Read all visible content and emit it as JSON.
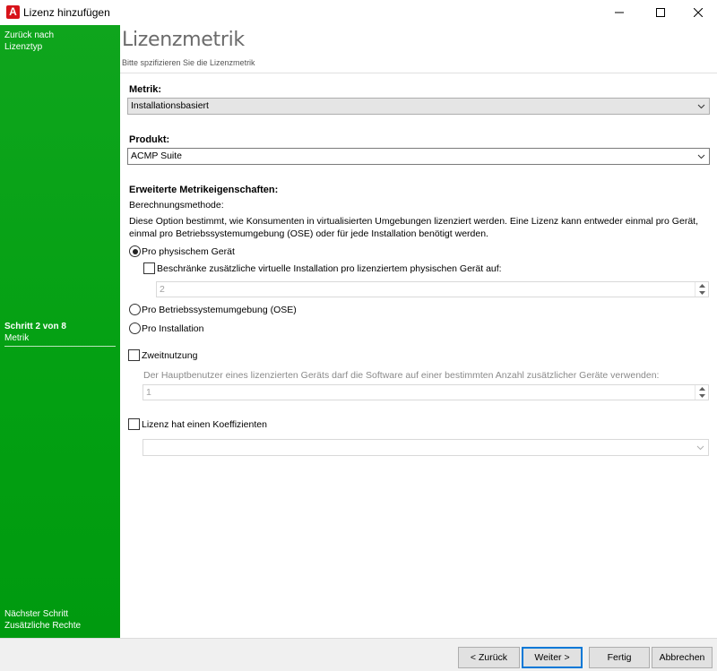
{
  "window": {
    "app_icon_letter": "A",
    "title": "Lizenz hinzufügen"
  },
  "sidebar": {
    "back_line1": "Zurück nach",
    "back_line2": "Lizenztyp",
    "step_label": "Schritt 2 von 8",
    "step_name": "Metrik",
    "next_line1": "Nächster Schritt",
    "next_line2": "Zusätzliche Rechte"
  },
  "header": {
    "title": "Lizenzmetrik",
    "subtitle": "Bitte spzifizieren Sie die Lizenzmetrik"
  },
  "form": {
    "metrik_label": "Metrik:",
    "metrik_value": "Installationsbasiert",
    "produkt_label": "Produkt:",
    "produkt_value": "ACMP Suite",
    "advanced_label": "Erweiterte Metrikeigenschaften:",
    "method_label": "Berechnungsmethode:",
    "description_line1": "Diese Option bestimmt, wie Konsumenten in virtualisierten Umgebungen lizenziert werden. Eine Lizenz kann entweder einmal pro Gerät,",
    "description_line2": "einmal pro Betriebssystemumgebung (OSE) oder für jede Installation benötigt werden.",
    "radio_physical": "Pro physischem Gerät",
    "restrict_label": "Beschränke zusätzliche virtuelle Installation pro lizenziertem physischen Gerät auf:",
    "restrict_value": "2",
    "radio_ose": "Pro Betriebssystemumgebung (OSE)",
    "radio_installation": "Pro Installation",
    "secondary_use_label": "Zweitnutzung",
    "secondary_use_desc": "Der Hauptbenutzer eines lizenzierten Geräts darf die Software auf einer bestimmten Anzahl zusätzlicher Geräte verwenden:",
    "secondary_use_value": "1",
    "coefficient_label": "Lizenz hat einen Koeffizienten",
    "coefficient_value": ""
  },
  "buttons": {
    "back": "< Zurück",
    "next": "Weiter >",
    "finish": "Fertig",
    "cancel": "Abbrechen"
  },
  "colors": {
    "sidebar_green": "#03a012",
    "default_button_border": "#0078d7",
    "brand_red": "#d7131a"
  }
}
